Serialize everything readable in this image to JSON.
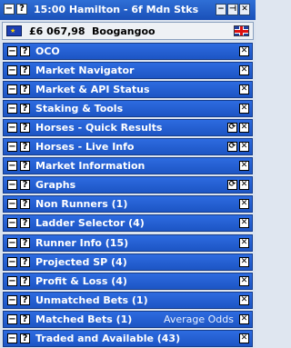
{
  "window": {
    "title": "15:00  Hamilton - 6f Mdn Stks",
    "menu_icon": "list-icon"
  },
  "balance": {
    "amount": "£6 067,98",
    "username": "Boogangoo",
    "currency_flag": "eu-flag-icon",
    "region_flag": "uk-flag-icon"
  },
  "panels": [
    {
      "label": "OCO",
      "refresh": false,
      "extra": ""
    },
    {
      "label": "Market Navigator",
      "refresh": false,
      "extra": ""
    },
    {
      "label": "Market & API Status",
      "refresh": false,
      "extra": ""
    },
    {
      "label": "Staking & Tools",
      "refresh": false,
      "extra": ""
    },
    {
      "label": "Horses - Quick Results",
      "refresh": true,
      "extra": ""
    },
    {
      "label": "Horses - Live Info",
      "refresh": true,
      "extra": ""
    },
    {
      "label": "Market Information",
      "refresh": false,
      "extra": ""
    },
    {
      "label": "Graphs",
      "refresh": true,
      "extra": ""
    },
    {
      "label": "Non Runners (1)",
      "refresh": false,
      "extra": ""
    },
    {
      "label": "Ladder Selector (4)",
      "refresh": false,
      "extra": ""
    },
    {
      "label": "Runner Info (15)",
      "refresh": false,
      "extra": ""
    },
    {
      "label": "Projected SP (4)",
      "refresh": false,
      "extra": ""
    },
    {
      "label": "Profit & Loss (4)",
      "refresh": false,
      "extra": ""
    },
    {
      "label": "Unmatched Bets (1)",
      "refresh": false,
      "extra": ""
    },
    {
      "label": "Matched Bets (1)",
      "refresh": false,
      "extra": "Average Odds"
    },
    {
      "label": "Traded and Available (43)",
      "refresh": false,
      "extra": ""
    }
  ],
  "symbols": {
    "minimize": "−",
    "help": "?",
    "close": "✕",
    "refresh": "⟳",
    "pin": "⊣",
    "restore": "▭"
  },
  "colors": {
    "panel_header": "#2d6be0",
    "title_bar": "#2f6fd6"
  }
}
